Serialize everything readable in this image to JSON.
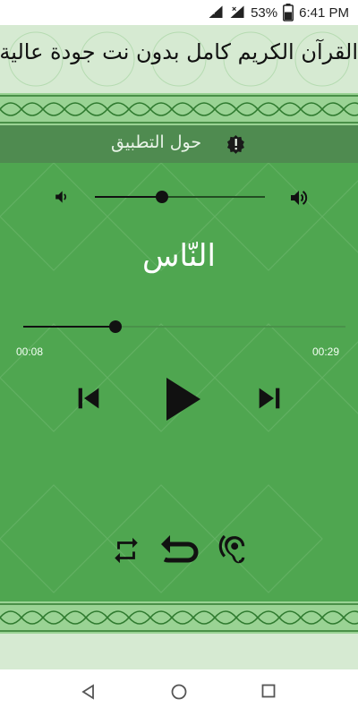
{
  "status_bar": {
    "battery": "53%",
    "time": "6:41 PM"
  },
  "header": {
    "title": "القرآن الكريم كامل بدون نت جودة عالية"
  },
  "about": {
    "label": "حول التطبيق"
  },
  "player": {
    "surah_name": "النّاس",
    "elapsed": "00:08",
    "duration": "00:29",
    "volume": 0.39,
    "progress": 0.28
  },
  "icons": {
    "volume_down": "volume-down-icon",
    "volume_up": "volume-up-icon",
    "previous": "skip-previous-icon",
    "play": "play-icon",
    "next": "skip-next-icon",
    "repeat": "repeat-icon",
    "replay": "replay-icon",
    "hearing": "hearing-icon",
    "info": "info-icon"
  }
}
